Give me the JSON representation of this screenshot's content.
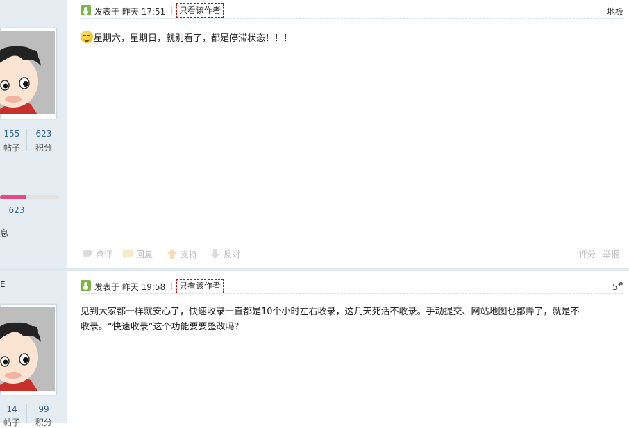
{
  "post1": {
    "posted_label": "发表于 昨天 17:51",
    "only_author": "只看该作者",
    "floor": "地板",
    "content": "星期六，星期日，就别看了，都是停滞状态！！！",
    "actions": {
      "comment": "点评",
      "reply": "回复",
      "support": "支持",
      "oppose": "反对",
      "rate": "评分",
      "report": "举报"
    }
  },
  "post2": {
    "posted_label": "发表于 昨天 19:58",
    "only_author": "只看该作者",
    "floor_num": "5",
    "floor_sup": "#",
    "content_line1": "见到大家都一样就安心了，快速收录一直都是10个小时左右收录，这几天死活不收录。手动提交、网站地图也都弄了，就是不",
    "content_line2": "收录。“快速收录”这个功能要要整改吗？"
  },
  "user1": {
    "posts_value": "155",
    "posts_label": "帖子",
    "credits_value": "623",
    "credits_label": "积分",
    "credit_bar_value": "623",
    "credit_progress": 0.43,
    "side_text": "息"
  },
  "user2": {
    "name_fragment": "E",
    "posts_value": "14",
    "posts_label": "帖子",
    "credits_value": "99",
    "credits_label": "积分"
  },
  "colors": {
    "sidebar_bg": "#e5edf2",
    "progress_fill": "#e64a86",
    "link": "#336699",
    "online_icon": "#7ab648"
  },
  "icons": [
    "online-icon",
    "smiley-icon",
    "comment-icon",
    "reply-icon",
    "support-icon",
    "oppose-icon",
    "avatar-cartoon"
  ]
}
